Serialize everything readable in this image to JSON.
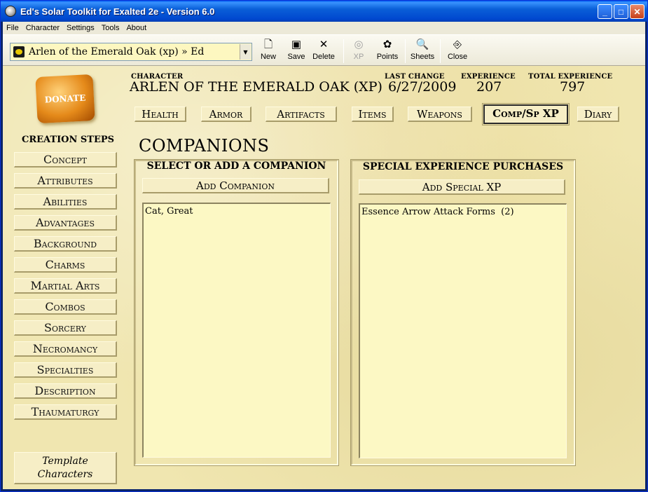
{
  "window": {
    "title": "Ed's Solar Toolkit for Exalted 2e - Version 6.0",
    "controls": [
      "minimize",
      "maximize",
      "close"
    ]
  },
  "menu": [
    "File",
    "Character",
    "Settings",
    "Tools",
    "About"
  ],
  "toolbar": {
    "character_select": "Arlen of the Emerald Oak (xp) » Ed",
    "buttons": {
      "new": "New",
      "save": "Save",
      "delete": "Delete",
      "xp": "XP",
      "points": "Points",
      "sheets": "Sheets",
      "close": "Close"
    }
  },
  "donate": "DONATE",
  "header": {
    "character_label": "CHARACTER",
    "character_name": "ARLEN OF THE EMERALD OAK (XP)",
    "last_change_label": "LAST CHANGE",
    "last_change": "6/27/2009",
    "experience_label": "EXPERIENCE",
    "experience": "207",
    "total_experience_label": "TOTAL EXPERIENCE",
    "total_experience": "797"
  },
  "tabs": [
    "Health",
    "Armor",
    "Artifacts",
    "Items",
    "Weapons",
    "Comp/Sp XP",
    "Diary"
  ],
  "active_tab": "Comp/Sp XP",
  "creation_steps": {
    "title": "CREATION STEPS",
    "items": [
      "Concept",
      "Attributes",
      "Abilities",
      "Advantages",
      "Background",
      "Charms",
      "Martial Arts",
      "Combos",
      "Sorcery",
      "Necromancy",
      "Specialties",
      "Description",
      "Thaumaturgy"
    ],
    "template_line1": "Template",
    "template_line2": "Characters"
  },
  "page": {
    "title": "COMPANIONS",
    "companions": {
      "title": "SELECT OR ADD A COMPANION",
      "add_label": "Add Companion",
      "items": [
        "Cat, Great"
      ]
    },
    "special_xp": {
      "title": "SPECIAL EXPERIENCE PURCHASES",
      "add_label": "Add Special XP",
      "items": [
        "Essence Arrow Attack Forms  (2)"
      ]
    }
  }
}
